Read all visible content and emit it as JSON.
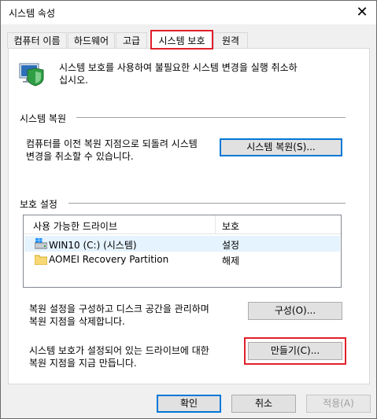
{
  "window": {
    "title": "시스템 속성",
    "close_glyph": "✕"
  },
  "tabs": [
    {
      "label": "컴퓨터 이름"
    },
    {
      "label": "하드웨어"
    },
    {
      "label": "고급"
    },
    {
      "label": "시스템 보호"
    },
    {
      "label": "원격"
    }
  ],
  "intro": {
    "icon": "system-protection-shield-icon",
    "text_line1": "시스템 보호를 사용하여 불필요한 시스템 변경을 실행 취소하",
    "text_line2": "십시오."
  },
  "restore": {
    "heading": "시스템 복원",
    "desc_line1": "컴퓨터를 이전 복원 지점으로 되돌려 시스템",
    "desc_line2": "변경을 취소할 수 있습니다.",
    "button": "시스템 복원(S)..."
  },
  "protection": {
    "heading": "보호 설정",
    "columns": [
      "사용 가능한 드라이브",
      "보호"
    ],
    "drives": [
      {
        "name": "WIN10 (C:) (시스템)",
        "status": "설정",
        "icon": "windows-drive-icon"
      },
      {
        "name": "AOMEI Recovery Partition",
        "status": "해제",
        "icon": "folder-drive-icon"
      }
    ],
    "config_line1": "복원 설정을 구성하고 디스크 공간을 관리하며",
    "config_line2": "복원 지점을 삭제합니다.",
    "config_button": "구성(O)...",
    "create_line1": "시스템 보호가 설정되어 있는 드라이브에 대한",
    "create_line2": "복원 지점을 지금 만듭니다.",
    "create_button": "만들기(C)..."
  },
  "footer": {
    "ok": "확인",
    "cancel": "취소",
    "apply": "적용(A)"
  },
  "colors": {
    "highlight": "#e0202a",
    "accent": "#0078d7",
    "selected_row": "#e5f3ff"
  }
}
